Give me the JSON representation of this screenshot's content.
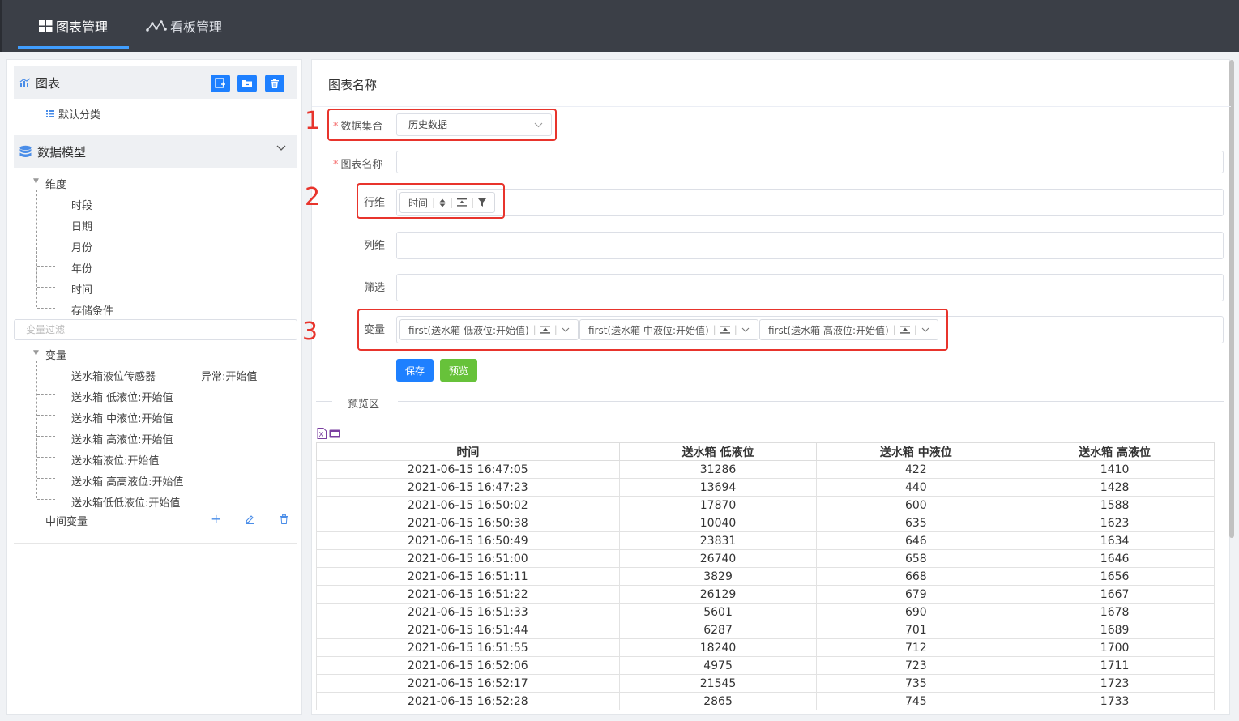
{
  "topnav": {
    "tab_charts": "图表管理",
    "tab_dashboards": "看板管理"
  },
  "sidebar": {
    "charts_title": "图表",
    "default_category": "默认分类",
    "model_title": "数据模型",
    "dimensions_label": "维度",
    "dimensions": [
      "时段",
      "日期",
      "月份",
      "年份",
      "时间",
      "存储条件"
    ],
    "filter_placeholder": "变量过滤",
    "variables_label": "变量",
    "variables": [
      {
        "name": "送水箱液位传感器",
        "extra": "异常:开始值"
      },
      {
        "name": "送水箱 低液位:开始值",
        "extra": ""
      },
      {
        "name": "送水箱 中液位:开始值",
        "extra": ""
      },
      {
        "name": "送水箱 高液位:开始值",
        "extra": ""
      },
      {
        "name": "送水箱液位:开始值",
        "extra": ""
      },
      {
        "name": "送水箱 高高液位:开始值",
        "extra": ""
      },
      {
        "name": "送水箱低低液位:开始值",
        "extra": ""
      }
    ],
    "intermediate_label": "中间变量"
  },
  "form": {
    "title": "图表名称",
    "dataset_label": "数据集合",
    "dataset_value": "历史数据",
    "chartname_label": "图表名称",
    "rowdim_label": "行维",
    "rowdim_chip": "时间",
    "coldim_label": "列维",
    "filter_label": "筛选",
    "variables_label": "变量",
    "var_chips": [
      "first(送水箱 低液位:开始值)",
      "first(送水箱 中液位:开始值)",
      "first(送水箱 高液位:开始值)"
    ],
    "save_label": "保存",
    "preview_label": "预览"
  },
  "annotations": [
    "1",
    "2",
    "3"
  ],
  "preview": {
    "label": "预览区",
    "columns": [
      "时间",
      "送水箱 低液位",
      "送水箱 中液位",
      "送水箱 高液位"
    ],
    "rows": [
      [
        "2021-06-15 16:47:05",
        "31286",
        "422",
        "1410"
      ],
      [
        "2021-06-15 16:47:23",
        "13694",
        "440",
        "1428"
      ],
      [
        "2021-06-15 16:50:02",
        "17870",
        "600",
        "1588"
      ],
      [
        "2021-06-15 16:50:38",
        "10040",
        "635",
        "1623"
      ],
      [
        "2021-06-15 16:50:49",
        "23831",
        "646",
        "1634"
      ],
      [
        "2021-06-15 16:51:00",
        "26740",
        "658",
        "1646"
      ],
      [
        "2021-06-15 16:51:11",
        "3829",
        "668",
        "1656"
      ],
      [
        "2021-06-15 16:51:22",
        "26129",
        "679",
        "1667"
      ],
      [
        "2021-06-15 16:51:33",
        "5601",
        "690",
        "1678"
      ],
      [
        "2021-06-15 16:51:44",
        "6287",
        "701",
        "1689"
      ],
      [
        "2021-06-15 16:51:55",
        "18240",
        "712",
        "1700"
      ],
      [
        "2021-06-15 16:52:06",
        "4975",
        "723",
        "1711"
      ],
      [
        "2021-06-15 16:52:17",
        "21545",
        "735",
        "1723"
      ],
      [
        "2021-06-15 16:52:28",
        "2865",
        "745",
        "1733"
      ]
    ]
  }
}
